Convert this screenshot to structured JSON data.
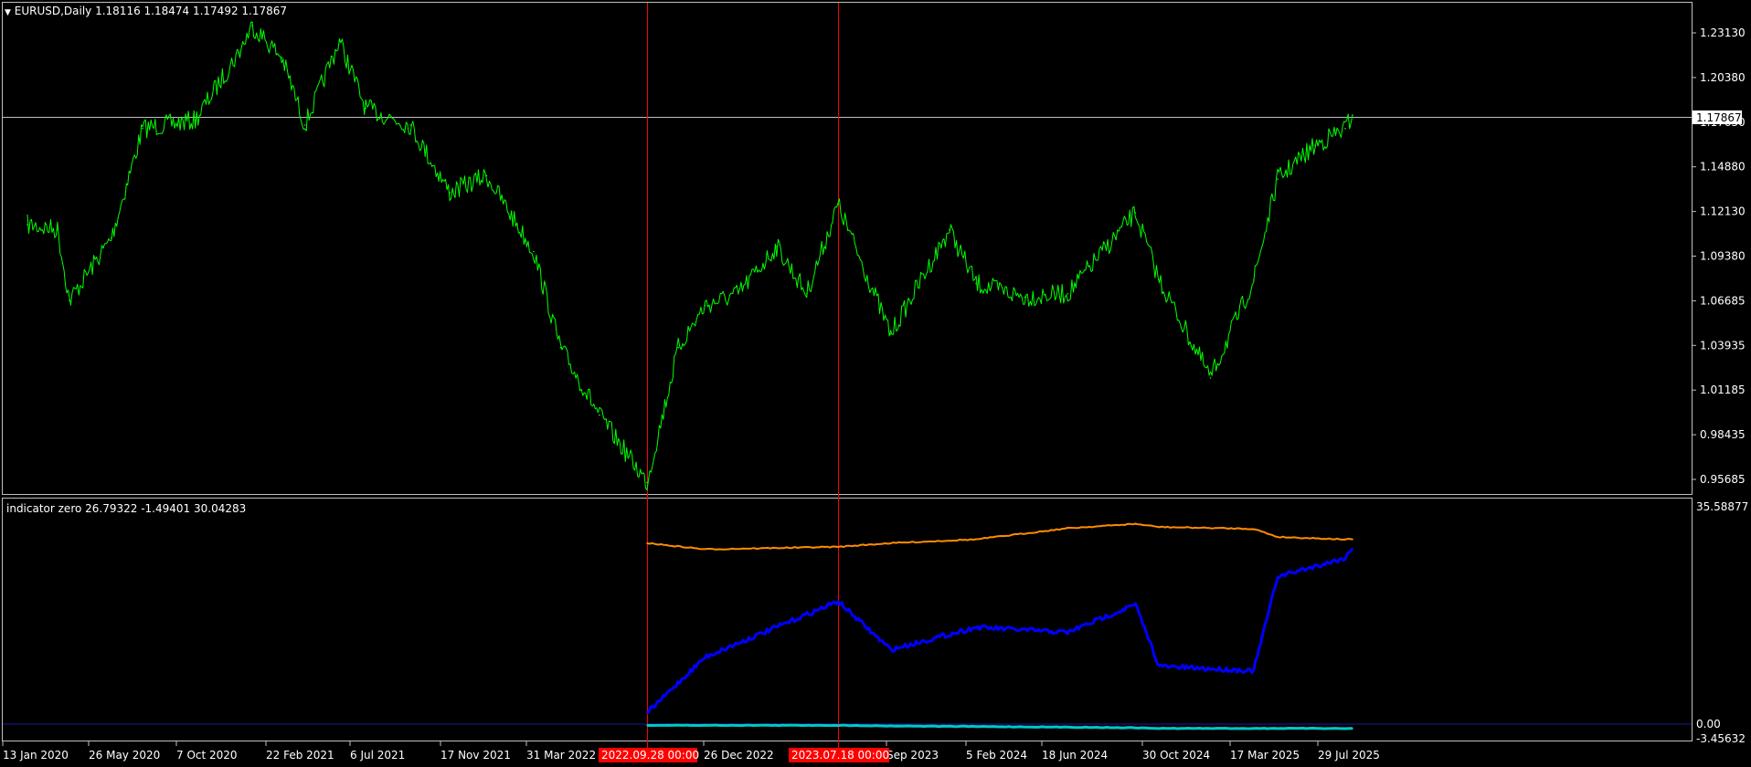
{
  "main_pane": {
    "label": "EURUSD,Daily  1.18116 1.18474 1.17492 1.17867",
    "price_ticks": [
      "1.23130",
      "1.20380",
      "1.17630",
      "1.14880",
      "1.12130",
      "1.09380",
      "1.06685",
      "1.03935",
      "1.01185",
      "0.98435",
      "0.95685"
    ],
    "current_price": "1.17867"
  },
  "indicator_pane": {
    "label": "indicator zero 26.79322 -1.49401 30.04283",
    "top_value": "35.58877",
    "zero_value": "0.00",
    "bottom_value": "-3.45632"
  },
  "time_axis": {
    "ticks": [
      "13 Jan 2020",
      "26 May 2020",
      "7 Oct 2020",
      "22 Feb 2021",
      "6 Jul 2021",
      "17 Nov 2021",
      "31 Mar 2022",
      "26 Dec 2022",
      "Sep 2023",
      "5 Feb 2024",
      "18 Jun 2024",
      "30 Oct 2024",
      "17 Mar 2025",
      "29 Jul 2025"
    ],
    "markers": [
      "2022.09.28 00:00",
      "2023.07.18 00:00"
    ]
  },
  "colors": {
    "background": "#000000",
    "price_line": "#00ff00",
    "indicator_upper": "#ff8c00",
    "indicator_main": "#0000ff",
    "indicator_lower": "#00c8c8",
    "marker": "#ff0000",
    "frame": "#c0c0c0"
  },
  "chart_data": {
    "type": "line",
    "price": {
      "name": "EURUSD,Daily",
      "x": [
        "2020-01-13",
        "2020-03-01",
        "2020-03-20",
        "2020-05-26",
        "2020-07-15",
        "2020-10-07",
        "2020-12-15",
        "2021-01-06",
        "2021-02-22",
        "2021-03-31",
        "2021-05-25",
        "2021-07-06",
        "2021-09-15",
        "2021-11-17",
        "2022-01-15",
        "2022-03-31",
        "2022-05-13",
        "2022-07-14",
        "2022-09-28",
        "2022-11-15",
        "2022-12-26",
        "2023-02-15",
        "2023-04-15",
        "2023-05-31",
        "2023-07-18",
        "2023-10-03",
        "2023-12-28",
        "2024-02-05",
        "2024-04-16",
        "2024-06-18",
        "2024-09-25",
        "2024-10-30",
        "2025-01-13",
        "2025-03-17",
        "2025-04-21",
        "2025-06-15",
        "2025-07-29",
        "2025-09-01"
      ],
      "y": [
        1.113,
        1.11,
        1.068,
        1.105,
        1.17,
        1.175,
        1.215,
        1.231,
        1.212,
        1.172,
        1.222,
        1.182,
        1.172,
        1.132,
        1.142,
        1.097,
        1.04,
        1.0,
        0.96,
        1.04,
        1.065,
        1.072,
        1.1,
        1.072,
        1.125,
        1.048,
        1.11,
        1.078,
        1.07,
        1.072,
        1.12,
        1.08,
        1.022,
        1.08,
        1.14,
        1.16,
        1.17,
        1.178
      ]
    },
    "indicator": {
      "x": [
        "2022-09-28",
        "2022-12-26",
        "2023-07-18",
        "2023-10-03",
        "2024-02-05",
        "2024-06-18",
        "2024-09-25",
        "2024-10-30",
        "2025-03-17",
        "2025-04-21",
        "2025-07-29",
        "2025-09-01"
      ],
      "upper": [
        28.4,
        27.4,
        27.8,
        28.4,
        29.0,
        30.8,
        31.5,
        31.0,
        30.7,
        29.4,
        29.0,
        29.0
      ],
      "main": [
        1.0,
        10.0,
        19.0,
        11.2,
        14.8,
        14.0,
        18.5,
        8.5,
        7.8,
        23.0,
        26.0,
        27.5
      ],
      "lower": [
        -1.0,
        -1.0,
        -1.0,
        -1.1,
        -1.2,
        -1.3,
        -1.4,
        -1.5,
        -1.5,
        -1.5,
        -1.5,
        -1.5
      ]
    },
    "ylim_price": [
      0.9532,
      1.2446
    ],
    "ylim_indicator": [
      -3.45632,
      35.58877
    ]
  }
}
